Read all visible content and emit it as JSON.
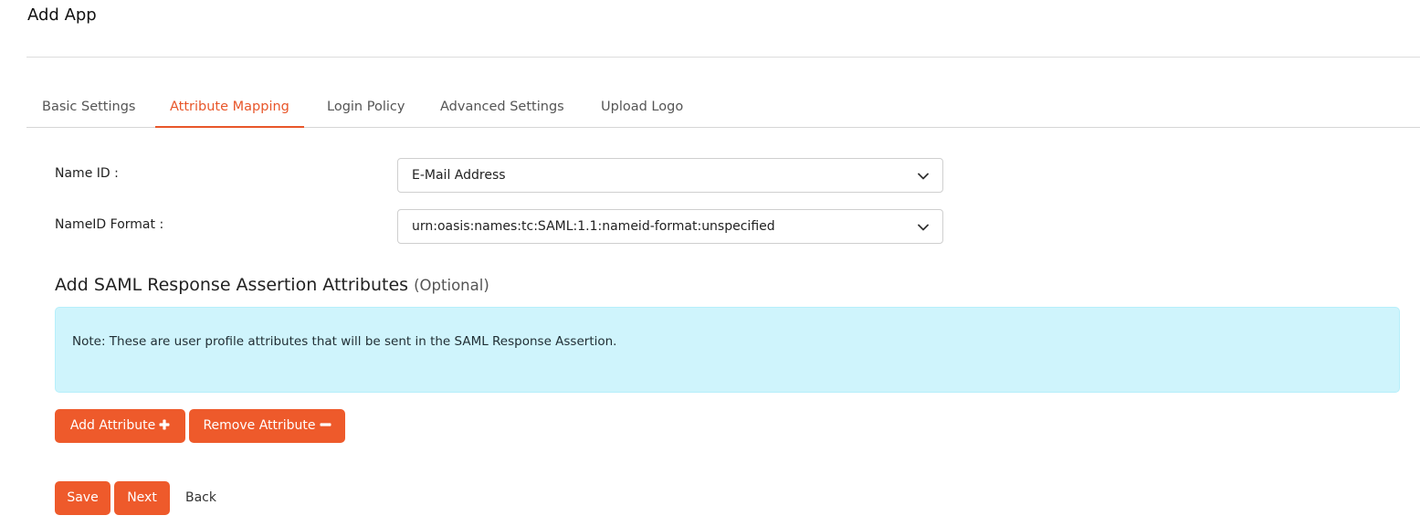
{
  "page": {
    "title": "Add App"
  },
  "tabs": [
    {
      "label": "Basic Settings",
      "active": false
    },
    {
      "label": "Attribute Mapping",
      "active": true
    },
    {
      "label": "Login Policy",
      "active": false
    },
    {
      "label": "Advanced Settings",
      "active": false
    },
    {
      "label": "Upload Logo",
      "active": false
    }
  ],
  "form": {
    "name_id": {
      "label": "Name ID :",
      "value": "E-Mail Address"
    },
    "nameid_format": {
      "label": "NameID Format :",
      "value": "urn:oasis:names:tc:SAML:1.1:nameid-format:unspecified"
    }
  },
  "attributes_section": {
    "heading": "Add SAML Response Assertion Attributes",
    "optional": "(Optional)",
    "note": "Note: These are user profile attributes that will be sent in the SAML Response Assertion.",
    "add_button": "Add Attribute",
    "remove_button": "Remove Attribute"
  },
  "footer": {
    "save": "Save",
    "next": "Next",
    "back": "Back"
  },
  "icons": {
    "chevron": "chevron-down-icon",
    "plus": "plus-icon",
    "minus": "minus-icon"
  },
  "colors": {
    "accent": "#ee5a2b",
    "tab_active": "#e8562a",
    "note_bg": "#cff4fc",
    "note_border": "#b6effb"
  }
}
